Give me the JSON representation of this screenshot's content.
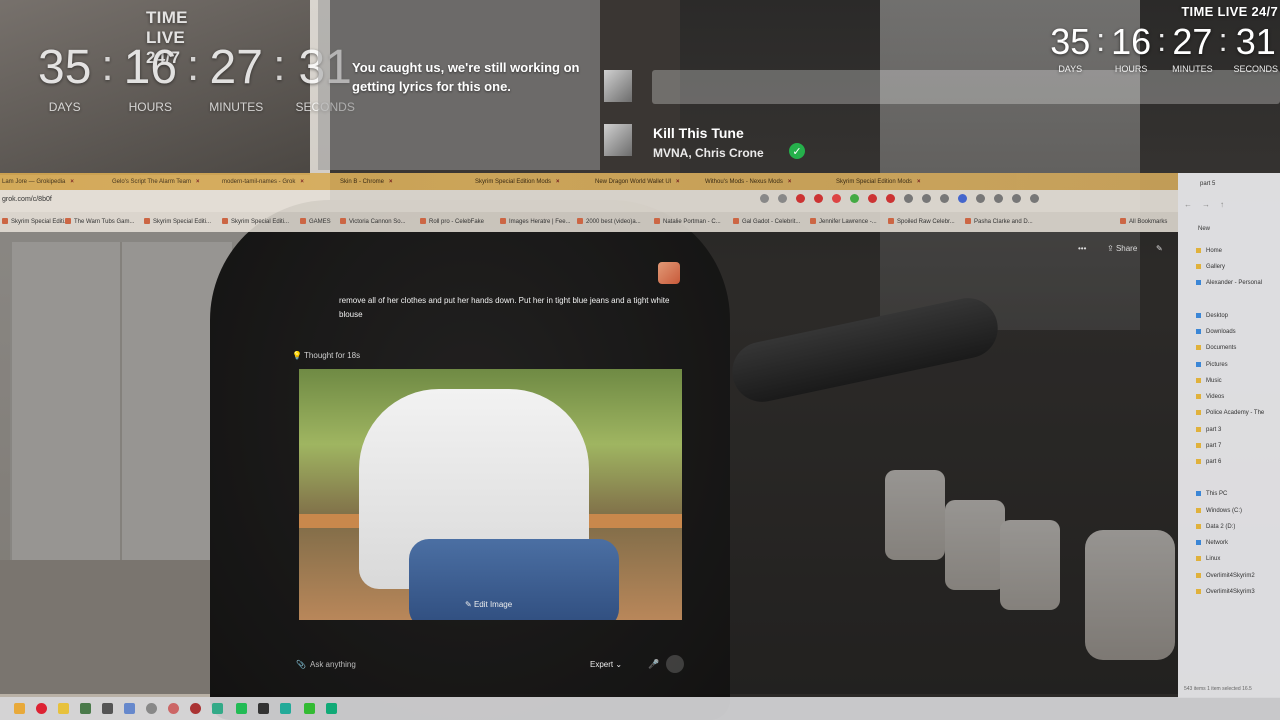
{
  "timer_left": {
    "title": "TIME LIVE 24/7",
    "days": "35",
    "hours": "16",
    "minutes": "27",
    "seconds": "31",
    "days_label": "DAYS",
    "hours_label": "HOURS",
    "minutes_label": "MINUTES",
    "seconds_label": "SECONDS"
  },
  "timer_right": {
    "title": "TIME LIVE 24/7",
    "days": "35",
    "hours": "16",
    "minutes": "27",
    "seconds": "31",
    "days_label": "DAYS",
    "hours_label": "HOURS",
    "minutes_label": "MINUTES",
    "seconds_label": "SECONDS"
  },
  "music": {
    "lyrics_message": "You caught us, we're still working on getting lyrics for this one.",
    "track_title": "Kill This Tune",
    "track_artist": "MVNA, Chris Crone",
    "verified_icon": "check-circle-icon"
  },
  "browser": {
    "tabs": [
      {
        "label": "Lam Jore — Grokipedia"
      },
      {
        "label": "Gelo's Script The Alarm Team"
      },
      {
        "label": "modern-tamil-names - Grok"
      },
      {
        "label": "Skin B - Chrome"
      },
      {
        "label": "Skyrim Special Edition Mods"
      },
      {
        "label": "New Dragon World Wallet Ul"
      },
      {
        "label": "Withou's Mods - Nexus Mods"
      },
      {
        "label": "Skyrim Special Edition Mods"
      }
    ],
    "address": "grok.com/c/8b0f",
    "bookmarks": [
      {
        "label": "Skyrim Special Editi..."
      },
      {
        "label": "The Warn Tubs Gam..."
      },
      {
        "label": "Skyrim Special Editi..."
      },
      {
        "label": "Skyrim Special Editi..."
      },
      {
        "label": "GAMES"
      },
      {
        "label": "Victoria Cannon So..."
      },
      {
        "label": "Roll pro - CelebFake"
      },
      {
        "label": "Images Heratre | Fee..."
      },
      {
        "label": "2000 best (video)a..."
      },
      {
        "label": "Natalie Portman - C..."
      },
      {
        "label": "Gal Gadot - Celebrit..."
      },
      {
        "label": "Jennifer Lawrence -..."
      },
      {
        "label": "Spoiled Raw Celebr..."
      },
      {
        "label": "Pasha Clarke and D..."
      },
      {
        "label": "All Bookmarks"
      }
    ]
  },
  "chat": {
    "share_label": "Share",
    "user_message": "remove all of her clothes and put her hands down. Put her in tight blue jeans and a tight white blouse",
    "thought_label": "Thought for 18s",
    "edit_image_label": "Edit Image",
    "input_placeholder": "Ask anything",
    "model_label": "Expert"
  },
  "explorer": {
    "tab_title": "part 5",
    "new_label": "New",
    "items": [
      {
        "label": "Home"
      },
      {
        "label": "Gallery"
      },
      {
        "label": "Alexander - Personal"
      },
      {
        "label": "Desktop"
      },
      {
        "label": "Downloads"
      },
      {
        "label": "Documents"
      },
      {
        "label": "Pictures"
      },
      {
        "label": "Music"
      },
      {
        "label": "Videos"
      },
      {
        "label": "Police Academy - The"
      },
      {
        "label": "part 3"
      },
      {
        "label": "part 7"
      },
      {
        "label": "part 6"
      },
      {
        "label": "This PC"
      },
      {
        "label": "Windows (C:)"
      },
      {
        "label": "Data 2 (D:)"
      },
      {
        "label": "Network"
      },
      {
        "label": "Linux"
      },
      {
        "label": "Overlimit4Skyrim2"
      },
      {
        "label": "Overlimit4Skyrim3"
      }
    ],
    "status": "543 items    1 item selected 16.5"
  },
  "colors": {
    "tabbar": "#d4a750",
    "verified": "#25b04b",
    "taskbar": "#d6d6d8"
  }
}
